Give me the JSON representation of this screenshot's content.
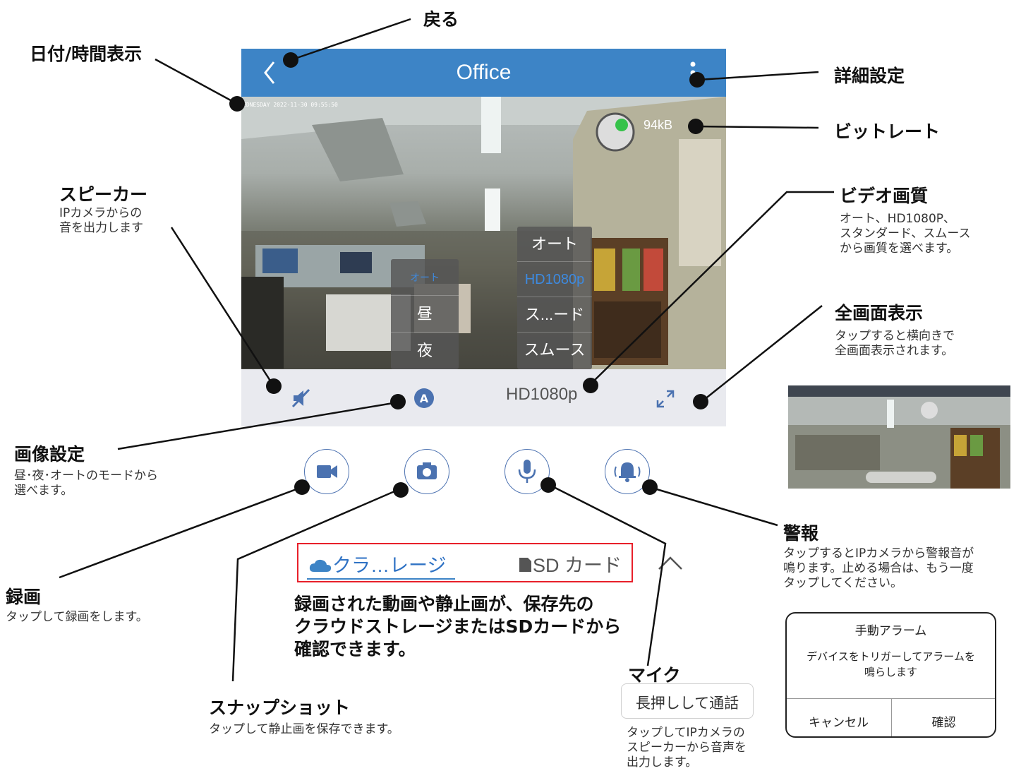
{
  "app": {
    "title": "Office",
    "video_timestamp": "EDNESDAY 2022-11-30 09:55:50",
    "bitrate": "94kB",
    "current_quality": "HD1080p",
    "accent_color": "#3d84c6"
  },
  "image_mode_menu": {
    "items": [
      {
        "label": "オート",
        "selected": true
      },
      {
        "label": "昼",
        "selected": false
      },
      {
        "label": "夜",
        "selected": false
      }
    ]
  },
  "quality_menu": {
    "items": [
      {
        "label": "オート",
        "selected": false
      },
      {
        "label": "HD1080p",
        "selected": true
      },
      {
        "label": "ス...ード",
        "selected": false
      },
      {
        "label": "スムース",
        "selected": false
      }
    ]
  },
  "controls": {
    "speaker_icon": "speaker-muted-icon",
    "image_mode_icon": "auto-mode-icon",
    "fullscreen_icon": "fullscreen-icon"
  },
  "actions": {
    "record_icon": "video-camera-icon",
    "snapshot_icon": "camera-icon",
    "mic_icon": "microphone-icon",
    "alarm_icon": "alarm-bell-icon"
  },
  "storage_tabs": {
    "cloud": "クラ…レージ",
    "sd": "SD カード"
  },
  "annotations": {
    "back": {
      "title": "戻る"
    },
    "datetime": {
      "title": "日付/時間表示"
    },
    "settings": {
      "title": "詳細設定"
    },
    "bitrate": {
      "title": "ビットレート"
    },
    "speaker": {
      "title": "スピーカー",
      "line1": "IPカメラからの",
      "line2": "音を出力します"
    },
    "video_quality": {
      "title": "ビデオ画質",
      "line1": "オート、HD1080P、",
      "line2": "スタンダード、スムース",
      "line3": "から画質を選べます。"
    },
    "fullscreen": {
      "title": "全画面表示",
      "line1": "タップすると横向きで",
      "line2": "全画面表示されます。"
    },
    "image_settings": {
      "title": "画像設定",
      "line1": "昼･夜･オートのモードから",
      "line2": "選べます。"
    },
    "alarm": {
      "title": "警報",
      "line1": "タップするとIPカメラから警報音が",
      "line2": "鳴ります。止める場合は、もう一度",
      "line3": "タップしてください。"
    },
    "record": {
      "title": "録画",
      "line1": "タップして録画をします。"
    },
    "storage": {
      "line1": "録画された動画や静止画が、保存先の",
      "line2": "クラウドストレージまたはSDカードから",
      "line3": "確認できます。"
    },
    "mic": {
      "title": "マイク",
      "line1": "タップしてIPカメラの",
      "line2": "スピーカーから音声を",
      "line3": "出力します。"
    },
    "snapshot": {
      "title": "スナップショット",
      "line1": "タップして静止画を保存できます。"
    }
  },
  "alarm_dialog": {
    "title": "手動アラーム",
    "message_line1": "デバイスをトリガーしてアラームを",
    "message_line2": "鳴らします",
    "cancel": "キャンセル",
    "confirm": "確認"
  },
  "mic_tooltip": {
    "text": "長押しして通話"
  }
}
